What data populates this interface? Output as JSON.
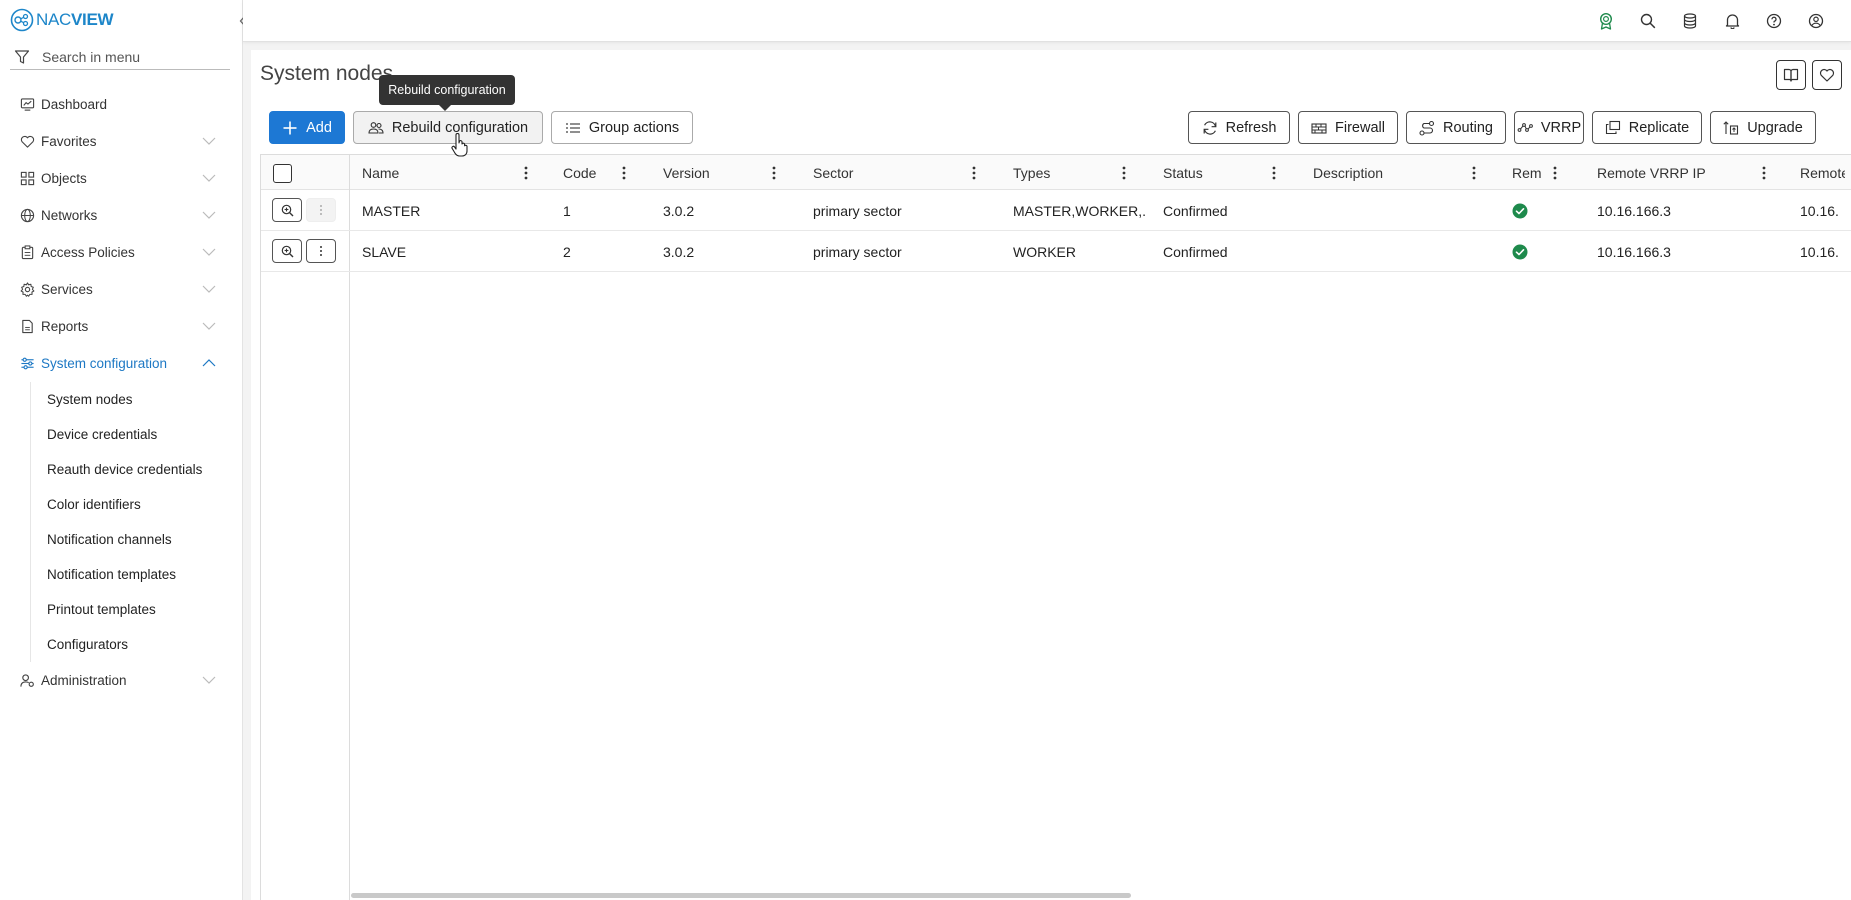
{
  "app": {
    "logo_prefix": "NAC",
    "logo_suffix": "VIEW"
  },
  "sidebar": {
    "search_placeholder": "Search in menu",
    "items": [
      {
        "label": "Dashboard",
        "icon": "dashboard-icon"
      },
      {
        "label": "Favorites",
        "icon": "heart-icon"
      },
      {
        "label": "Objects",
        "icon": "objects-icon"
      },
      {
        "label": "Networks",
        "icon": "globe-icon"
      },
      {
        "label": "Access Policies",
        "icon": "clipboard-icon"
      },
      {
        "label": "Services",
        "icon": "gear-icon"
      },
      {
        "label": "Reports",
        "icon": "report-icon"
      },
      {
        "label": "System configuration",
        "icon": "sliders-icon"
      },
      {
        "label": "Administration",
        "icon": "users-gear-icon"
      }
    ],
    "sub_items": [
      "System nodes",
      "Device credentials",
      "Reauth device credentials",
      "Color identifiers",
      "Notification channels",
      "Notification templates",
      "Printout templates",
      "Configurators"
    ]
  },
  "page": {
    "title": "System nodes",
    "tooltip": "Rebuild configuration"
  },
  "toolbar": {
    "add": "Add",
    "rebuild": "Rebuild configuration",
    "group_actions": "Group actions",
    "refresh": "Refresh",
    "firewall": "Firewall",
    "routing": "Routing",
    "vrrp": "VRRP",
    "replicate": "Replicate",
    "upgrade": "Upgrade"
  },
  "table": {
    "headers": [
      "Name",
      "Code",
      "Version",
      "Sector",
      "Types",
      "Status",
      "Description",
      "Remote",
      "Remote VRRP IP",
      "Remote"
    ],
    "rows": [
      {
        "name": "MASTER",
        "code": "1",
        "version": "3.0.2",
        "sector": "primary sector",
        "types": "MASTER,WORKER,...",
        "status": "Confirmed",
        "description": "",
        "remote_ok": true,
        "remote_vrrp_ip": "10.16.166.3",
        "remote_extra": "10.16."
      },
      {
        "name": "SLAVE",
        "code": "2",
        "version": "3.0.2",
        "sector": "primary sector",
        "types": "WORKER",
        "status": "Confirmed",
        "description": "",
        "remote_ok": true,
        "remote_vrrp_ip": "10.16.166.3",
        "remote_extra": "10.16."
      }
    ]
  },
  "colors": {
    "accent": "#1d78d4",
    "active_nav": "#1d78c4",
    "ok_green": "#1e8a4c"
  }
}
